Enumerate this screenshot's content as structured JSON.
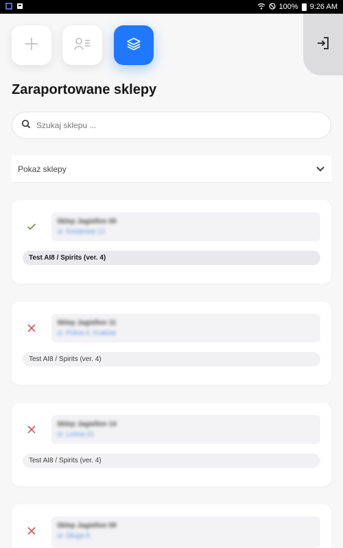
{
  "status_bar": {
    "battery": "100%",
    "time": "9:26 AM"
  },
  "toolbar": {
    "add_icon": "plus-icon",
    "contacts_icon": "contact-list-icon",
    "layers_icon": "layers-icon",
    "logout_icon": "login-arrow-icon",
    "accent_color": "#1f78ff"
  },
  "page": {
    "title": "Zaraportowane sklepy"
  },
  "search": {
    "placeholder": "Szukaj sklepu ..."
  },
  "filter": {
    "label": "Pokaż sklepy"
  },
  "shops": [
    {
      "status": "reported",
      "name": "Sklep Jagiellon 00",
      "address": "ul. Kwiatowa 12",
      "survey": "Test AI8 / Spirits (ver. 4)"
    },
    {
      "status": "not-reported",
      "name": "Sklep Jagiellon 11",
      "address": "ul. Polna 4, Kraków",
      "survey": "Test AI8 / Spirits (ver. 4)"
    },
    {
      "status": "not-reported",
      "name": "Sklep Jagiellon 14",
      "address": "ul. Leśna 21",
      "survey": "Test AI8 / Spirits (ver. 4)"
    },
    {
      "status": "not-reported",
      "name": "Sklep Jagiellon 09",
      "address": "ul. Długa 8",
      "survey": ""
    }
  ]
}
